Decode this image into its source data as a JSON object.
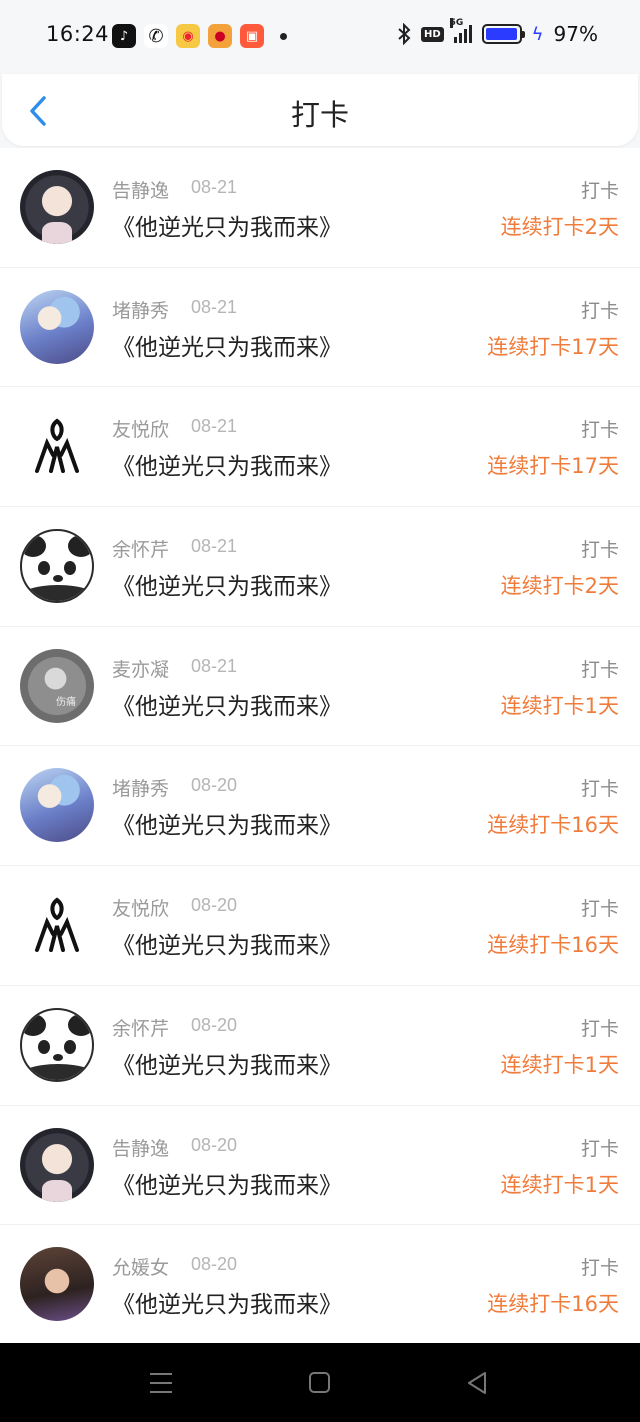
{
  "status_bar": {
    "time": "16:24",
    "battery_text": "97%",
    "battery_level": 0.97,
    "network": "5G",
    "hd": "HD"
  },
  "nav": {
    "title": "打卡"
  },
  "checkins": [
    {
      "name": "告静逸",
      "date": "08-21",
      "title": "《他逆光只为我而来》",
      "action": "打卡",
      "streak": "连续打卡2天",
      "avatar": "girl1"
    },
    {
      "name": "堵静秀",
      "date": "08-21",
      "title": "《他逆光只为我而来》",
      "action": "打卡",
      "streak": "连续打卡17天",
      "avatar": "anime"
    },
    {
      "name": "友悦欣",
      "date": "08-21",
      "title": "《他逆光只为我而来》",
      "action": "打卡",
      "streak": "连续打卡17天",
      "avatar": "logo"
    },
    {
      "name": "余怀芹",
      "date": "08-21",
      "title": "《他逆光只为我而来》",
      "action": "打卡",
      "streak": "连续打卡2天",
      "avatar": "panda"
    },
    {
      "name": "麦亦凝",
      "date": "08-21",
      "title": "《他逆光只为我而来》",
      "action": "打卡",
      "streak": "连续打卡1天",
      "avatar": "gray"
    },
    {
      "name": "堵静秀",
      "date": "08-20",
      "title": "《他逆光只为我而来》",
      "action": "打卡",
      "streak": "连续打卡16天",
      "avatar": "anime"
    },
    {
      "name": "友悦欣",
      "date": "08-20",
      "title": "《他逆光只为我而来》",
      "action": "打卡",
      "streak": "连续打卡16天",
      "avatar": "logo"
    },
    {
      "name": "余怀芹",
      "date": "08-20",
      "title": "《他逆光只为我而来》",
      "action": "打卡",
      "streak": "连续打卡1天",
      "avatar": "panda"
    },
    {
      "name": "告静逸",
      "date": "08-20",
      "title": "《他逆光只为我而来》",
      "action": "打卡",
      "streak": "连续打卡1天",
      "avatar": "girl1"
    },
    {
      "name": "允媛女",
      "date": "08-20",
      "title": "《他逆光只为我而来》",
      "action": "打卡",
      "streak": "连续打卡16天",
      "avatar": "boy"
    }
  ],
  "colors": {
    "accent_orange": "#f07c3c",
    "back_blue": "#2f8fe8",
    "battery_blue": "#2b3bff"
  }
}
